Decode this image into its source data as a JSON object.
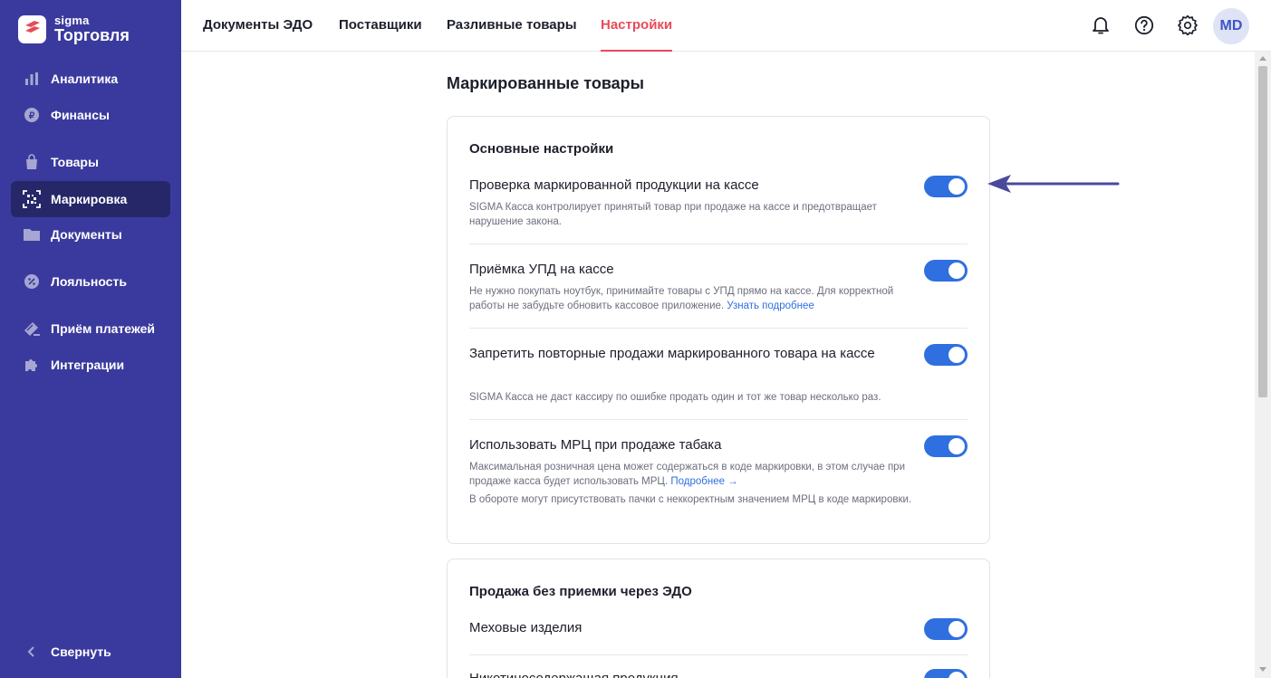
{
  "brand": {
    "small": "sigma",
    "big": "Торговля"
  },
  "sidebar": {
    "items": [
      {
        "label": "Аналитика"
      },
      {
        "label": "Финансы"
      },
      {
        "label": "Товары"
      },
      {
        "label": "Маркировка"
      },
      {
        "label": "Документы"
      },
      {
        "label": "Лояльность"
      },
      {
        "label": "Приём платежей"
      },
      {
        "label": "Интеграции"
      }
    ],
    "collapse_label": "Свернуть"
  },
  "topnav": {
    "tabs": [
      {
        "label": "Документы ЭДО"
      },
      {
        "label": "Поставщики"
      },
      {
        "label": "Разливные товары"
      },
      {
        "label": "Настройки"
      }
    ],
    "avatar": "MD"
  },
  "page": {
    "title": "Маркированные товары"
  },
  "card1": {
    "title": "Основные настройки",
    "rows": [
      {
        "title": "Проверка маркированной продукции на кассе",
        "desc": "SIGMA Касса контролирует принятый товар при продаже на кассе и предотвращает нарушение закона.",
        "enabled": true
      },
      {
        "title": "Приёмка УПД на кассе",
        "desc": "Не нужно покупать ноутбук, принимайте товары с УПД прямо на кассе. Для корректной работы не забудьте обновить кассовое приложение.",
        "link": "Узнать подробнее",
        "enabled": true
      },
      {
        "title": "Запретить повторные продажи маркированного товара на кассе",
        "desc": "SIGMA Касса не даст кассиру по ошибке продать один и тот же товар несколько раз.",
        "enabled": true
      },
      {
        "title": "Использовать МРЦ при продаже табака",
        "desc": "Максимальная розничная цена может содержаться в коде маркировки, в этом случае при продаже касса будет использовать МРЦ.",
        "link": "Подробнее →",
        "desc2": "В обороте могут присутствовать пачки с неккоректным значением МРЦ в коде маркировки.",
        "enabled": true
      }
    ]
  },
  "card2": {
    "title": "Продажа без приемки через ЭДО",
    "rows": [
      {
        "title": "Меховые изделия",
        "enabled": true
      },
      {
        "title": "Никотиносодержащая продукция",
        "enabled": true
      }
    ]
  },
  "colors": {
    "sidebar": "#3a3a9e",
    "sidebar_active": "#262768",
    "accent": "#e84a5a",
    "toggle_on": "#2f6fe0",
    "arrow": "#4a4a9c"
  }
}
